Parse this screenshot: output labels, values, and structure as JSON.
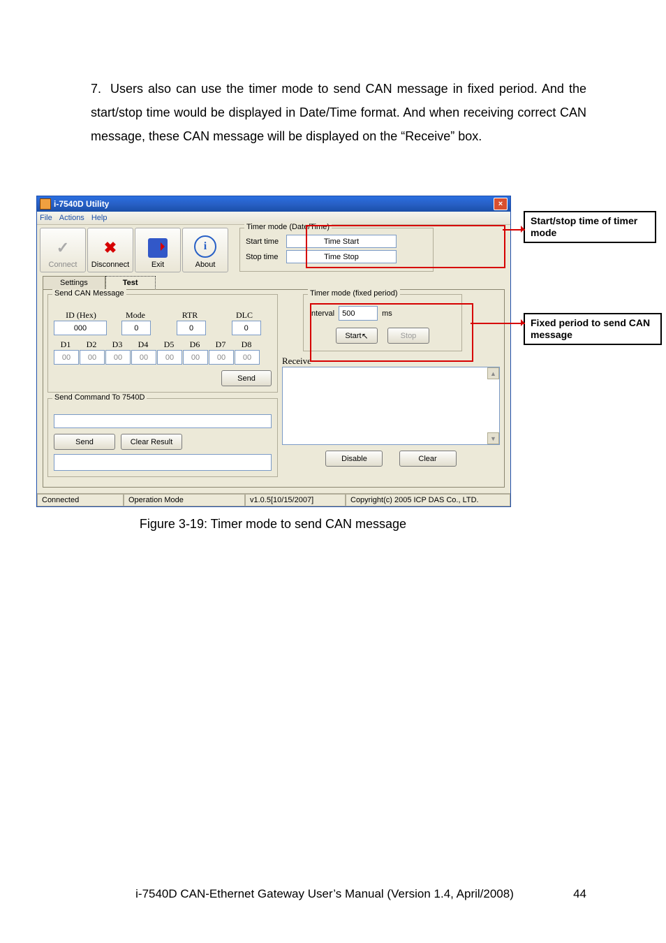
{
  "paragraph": {
    "number": "7.",
    "text": "Users also can use the timer mode to send CAN message in fixed period. And the start/stop time would be displayed in Date/Time format. And when receiving correct CAN message, these CAN message will be displayed on the “Receive” box."
  },
  "window": {
    "title": "i-7540D Utility",
    "menu": {
      "file": "File",
      "actions": "Actions",
      "help": "Help"
    },
    "toolbar": {
      "connect": "Connect",
      "disconnect": "Disconnect",
      "exit": "Exit",
      "about": "About"
    },
    "timer_date": {
      "legend": "Timer mode  (Date/Time)",
      "start_label": "Start time",
      "start_value": "Time Start",
      "stop_label": "Stop time",
      "stop_value": "Time Stop"
    },
    "tabs": {
      "settings": "Settings",
      "test": "Test"
    },
    "send_can": {
      "legend": "Send CAN Message",
      "id_label": "ID (Hex)",
      "mode_label": "Mode",
      "rtr_label": "RTR",
      "dlc_label": "DLC",
      "id_value": "000",
      "mode_value": "0",
      "rtr_value": "0",
      "dlc_value": "0",
      "d_labels": [
        "D1",
        "D2",
        "D3",
        "D4",
        "D5",
        "D6",
        "D7",
        "D8"
      ],
      "d_values": [
        "00",
        "00",
        "00",
        "00",
        "00",
        "00",
        "00",
        "00"
      ],
      "send_btn": "Send"
    },
    "send_cmd": {
      "legend": "Send Command To 7540D",
      "send_btn": "Send",
      "clear_btn": "Clear Result"
    },
    "timer_fixed": {
      "legend": "Timer mode (fixed period)",
      "interval_label": "Interval",
      "interval_value": "500",
      "interval_unit": "ms",
      "start_btn": "Start",
      "stop_btn": "Stop"
    },
    "receive": {
      "label": "Receive",
      "disable_btn": "Disable",
      "clear_btn": "Clear"
    },
    "status": {
      "conn": "Connected",
      "mode": "Operation Mode",
      "ver": "v1.0.5[10/15/2007]",
      "copy": "Copyright(c) 2005 ICP DAS Co., LTD."
    }
  },
  "callouts": {
    "c1": "Start/stop time of timer mode",
    "c2": "Fixed period to send CAN message"
  },
  "figure_caption": "Figure 3-19:  Timer mode to send CAN message",
  "footer": {
    "text": "i-7540D CAN-Ethernet Gateway User’s Manual (Version 1.4, April/2008)",
    "page": "44"
  }
}
